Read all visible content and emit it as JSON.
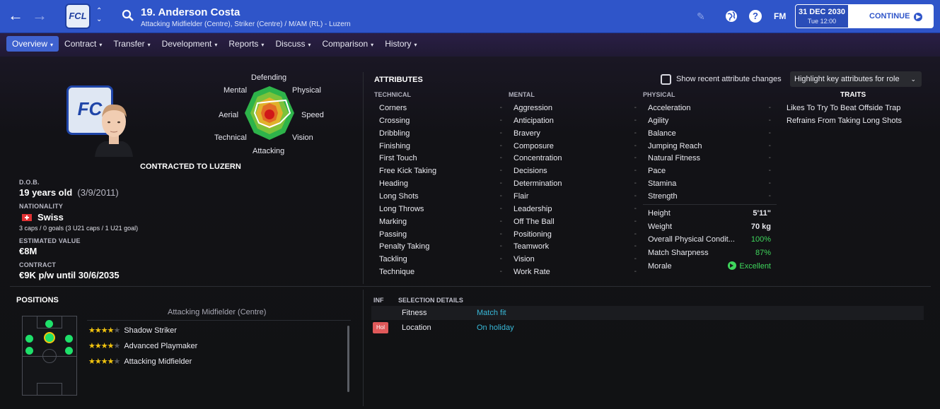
{
  "header": {
    "back_icon": "←",
    "forward_icon": "→",
    "club_badge_text": "FCL",
    "player_name": "19. Anderson Costa",
    "player_subtitle": "Attacking Midfielder (Centre), Striker (Centre) / M/AM (RL) - Luzern",
    "help_label": "?",
    "fm_label": "FM",
    "date": "31 DEC 2030",
    "time": "Tue 12:00",
    "continue_label": "CONTINUE",
    "accent_color": "#2f55c9"
  },
  "nav": {
    "tabs": [
      {
        "label": "Overview",
        "active": true
      },
      {
        "label": "Contract"
      },
      {
        "label": "Transfer"
      },
      {
        "label": "Development"
      },
      {
        "label": "Reports"
      },
      {
        "label": "Discuss"
      },
      {
        "label": "Comparison"
      },
      {
        "label": "History"
      }
    ]
  },
  "profile": {
    "crest_text": "FC",
    "contracted_label": "CONTRACTED TO LUZERN",
    "dob_label": "D.O.B.",
    "dob_age": "19 years old",
    "dob_date": "(3/9/2011)",
    "nationality_label": "NATIONALITY",
    "nationality": "Swiss",
    "caps": "3 caps / 0 goals (3 U21 caps / 1 U21 goal)",
    "value_label": "ESTIMATED VALUE",
    "value": "€8M",
    "contract_label": "CONTRACT",
    "contract": "€9K p/w until 30/6/2035"
  },
  "radar": {
    "labels": [
      "Defending",
      "Physical",
      "Speed",
      "Vision",
      "Attacking",
      "Technical",
      "Aerial",
      "Mental"
    ]
  },
  "attributes": {
    "title": "ATTRIBUTES",
    "show_changes_label": "Show recent attribute changes",
    "highlight_label": "Highlight key attributes for role",
    "technical_label": "TECHNICAL",
    "mental_label": "MENTAL",
    "physical_label": "PHYSICAL",
    "technical": [
      "Corners",
      "Crossing",
      "Dribbling",
      "Finishing",
      "First Touch",
      "Free Kick Taking",
      "Heading",
      "Long Shots",
      "Long Throws",
      "Marking",
      "Passing",
      "Penalty Taking",
      "Tackling",
      "Technique"
    ],
    "mental": [
      "Aggression",
      "Anticipation",
      "Bravery",
      "Composure",
      "Concentration",
      "Decisions",
      "Determination",
      "Flair",
      "Leadership",
      "Off The Ball",
      "Positioning",
      "Teamwork",
      "Vision",
      "Work Rate"
    ],
    "physical": [
      "Acceleration",
      "Agility",
      "Balance",
      "Jumping Reach",
      "Natural Fitness",
      "Pace",
      "Stamina",
      "Strength"
    ],
    "value_placeholder": "-"
  },
  "physical_info": {
    "height_label": "Height",
    "height": "5'11\"",
    "weight_label": "Weight",
    "weight": "70 kg",
    "fitness_label": "Overall Physical Condit...",
    "fitness": "100%",
    "sharpness_label": "Match Sharpness",
    "sharpness": "87%",
    "morale_label": "Morale",
    "morale": "Excellent"
  },
  "traits": {
    "title": "TRAITS",
    "items": [
      "Likes To Try To Beat Offside Trap",
      "Refrains From Taking Long Shots"
    ]
  },
  "positions": {
    "title": "POSITIONS",
    "selected_role": "Attacking Midfielder (Centre)",
    "roles": [
      {
        "name": "Shadow Striker",
        "stars": 4
      },
      {
        "name": "Advanced Playmaker",
        "stars": 4
      },
      {
        "name": "Attacking Midfielder",
        "stars": 4
      }
    ]
  },
  "selection": {
    "inf_label": "INF",
    "title": "SELECTION DETAILS",
    "rows": [
      {
        "label": "Fitness",
        "value": "Match fit",
        "badge": ""
      },
      {
        "label": "Location",
        "value": "On holiday",
        "badge": "Hol"
      }
    ]
  }
}
